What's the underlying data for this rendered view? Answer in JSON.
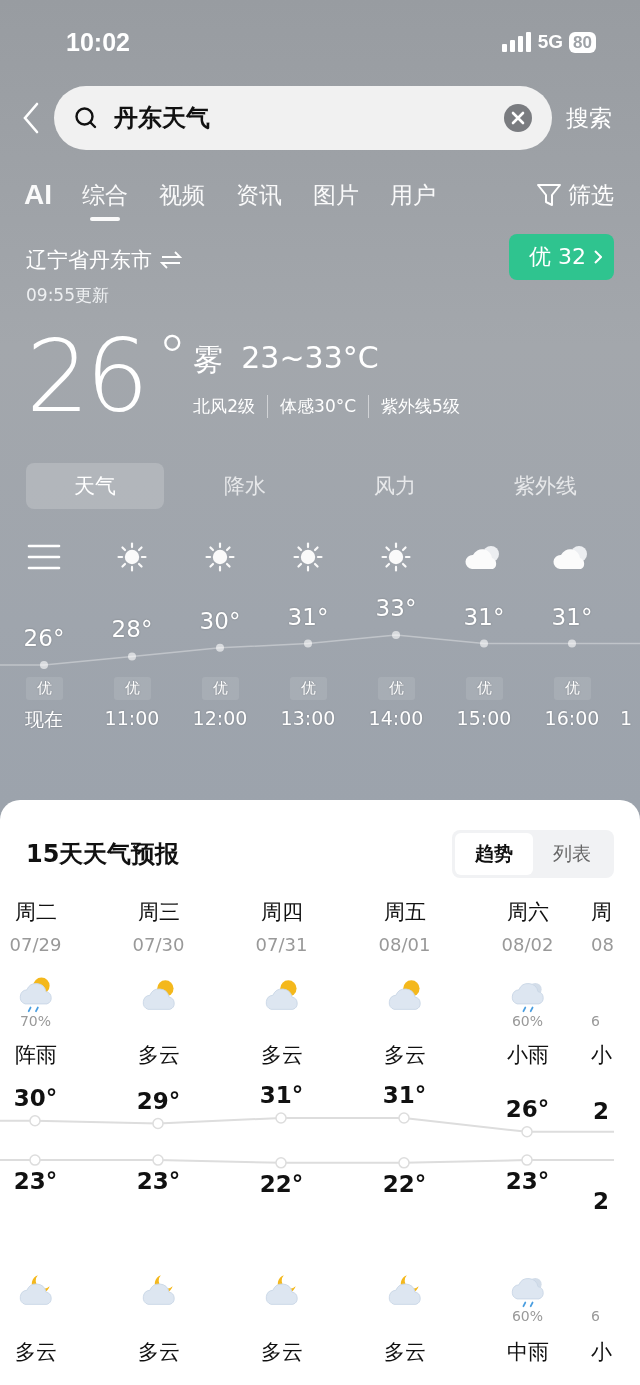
{
  "status_bar": {
    "time": "10:02",
    "network": "5G",
    "battery": "80"
  },
  "search": {
    "value": "丹东天气",
    "submit": "搜索"
  },
  "tabs": [
    {
      "label": "AI",
      "kind": "ai",
      "selected": false
    },
    {
      "label": "综合",
      "kind": "tab",
      "selected": true
    },
    {
      "label": "视频",
      "kind": "tab",
      "selected": false
    },
    {
      "label": "资讯",
      "kind": "tab",
      "selected": false
    },
    {
      "label": "图片",
      "kind": "tab",
      "selected": false
    },
    {
      "label": "用户",
      "kind": "tab",
      "selected": false
    }
  ],
  "filter": "筛选",
  "location": {
    "name": "辽宁省丹东市",
    "updated": "09:55更新",
    "aqi": "优 32"
  },
  "current": {
    "temp": "26",
    "unit": "°",
    "condition": "雾",
    "range": "23~33°C",
    "details": [
      "北风2级",
      "体感30°C",
      "紫外线5级"
    ]
  },
  "hourly_tabs": [
    {
      "label": "天气",
      "selected": true
    },
    {
      "label": "降水",
      "selected": false
    },
    {
      "label": "风力",
      "selected": false
    },
    {
      "label": "紫外线",
      "selected": false
    }
  ],
  "hourly": [
    {
      "kind": "menu",
      "temp": "26°",
      "aqi": "优",
      "time": "现在"
    },
    {
      "kind": "sunny",
      "temp": "28°",
      "aqi": "优",
      "time": "11:00"
    },
    {
      "kind": "sunny",
      "temp": "30°",
      "aqi": "优",
      "time": "12:00"
    },
    {
      "kind": "sunny",
      "temp": "31°",
      "aqi": "优",
      "time": "13:00"
    },
    {
      "kind": "sunny",
      "temp": "33°",
      "aqi": "优",
      "time": "14:00"
    },
    {
      "kind": "cloudy",
      "temp": "31°",
      "aqi": "优",
      "time": "15:00"
    },
    {
      "kind": "cloudy",
      "temp": "31°",
      "aqi": "优",
      "time": "16:00"
    },
    {
      "kind": "partial",
      "time": "1"
    }
  ],
  "forecast": {
    "title": "15天天气预报",
    "views": [
      {
        "label": "趋势",
        "selected": true
      },
      {
        "label": "列表",
        "selected": false
      }
    ],
    "days": [
      {
        "weekday": "周二",
        "date": "07/29",
        "day": {
          "kind": "shower",
          "pop": "70%",
          "condition": "阵雨"
        },
        "high": "30°",
        "low": "23°",
        "night": {
          "kind": "cloudy-night",
          "condition": "多云"
        }
      },
      {
        "weekday": "周三",
        "date": "07/30",
        "day": {
          "kind": "partly-cloudy",
          "condition": "多云"
        },
        "high": "29°",
        "low": "23°",
        "night": {
          "kind": "cloudy-night",
          "condition": "多云"
        }
      },
      {
        "weekday": "周四",
        "date": "07/31",
        "day": {
          "kind": "partly-cloudy",
          "condition": "多云"
        },
        "high": "31°",
        "low": "22°",
        "night": {
          "kind": "cloudy-night",
          "condition": "多云"
        }
      },
      {
        "weekday": "周五",
        "date": "08/01",
        "day": {
          "kind": "partly-cloudy",
          "condition": "多云"
        },
        "high": "31°",
        "low": "22°",
        "night": {
          "kind": "cloudy-night",
          "condition": "多云"
        }
      },
      {
        "weekday": "周六",
        "date": "08/02",
        "day": {
          "kind": "rain",
          "pop": "60%",
          "condition": "小雨"
        },
        "high": "26°",
        "low": "23°",
        "night": {
          "kind": "rain",
          "pop": "60%",
          "condition": "中雨"
        }
      },
      {
        "weekday": "周",
        "date": "08",
        "day": {
          "kind": "partial",
          "pop": "6",
          "condition": "小"
        },
        "high": "2",
        "low": "2",
        "night": {
          "kind": "partial",
          "pop": "6",
          "condition": "小"
        }
      }
    ]
  }
}
